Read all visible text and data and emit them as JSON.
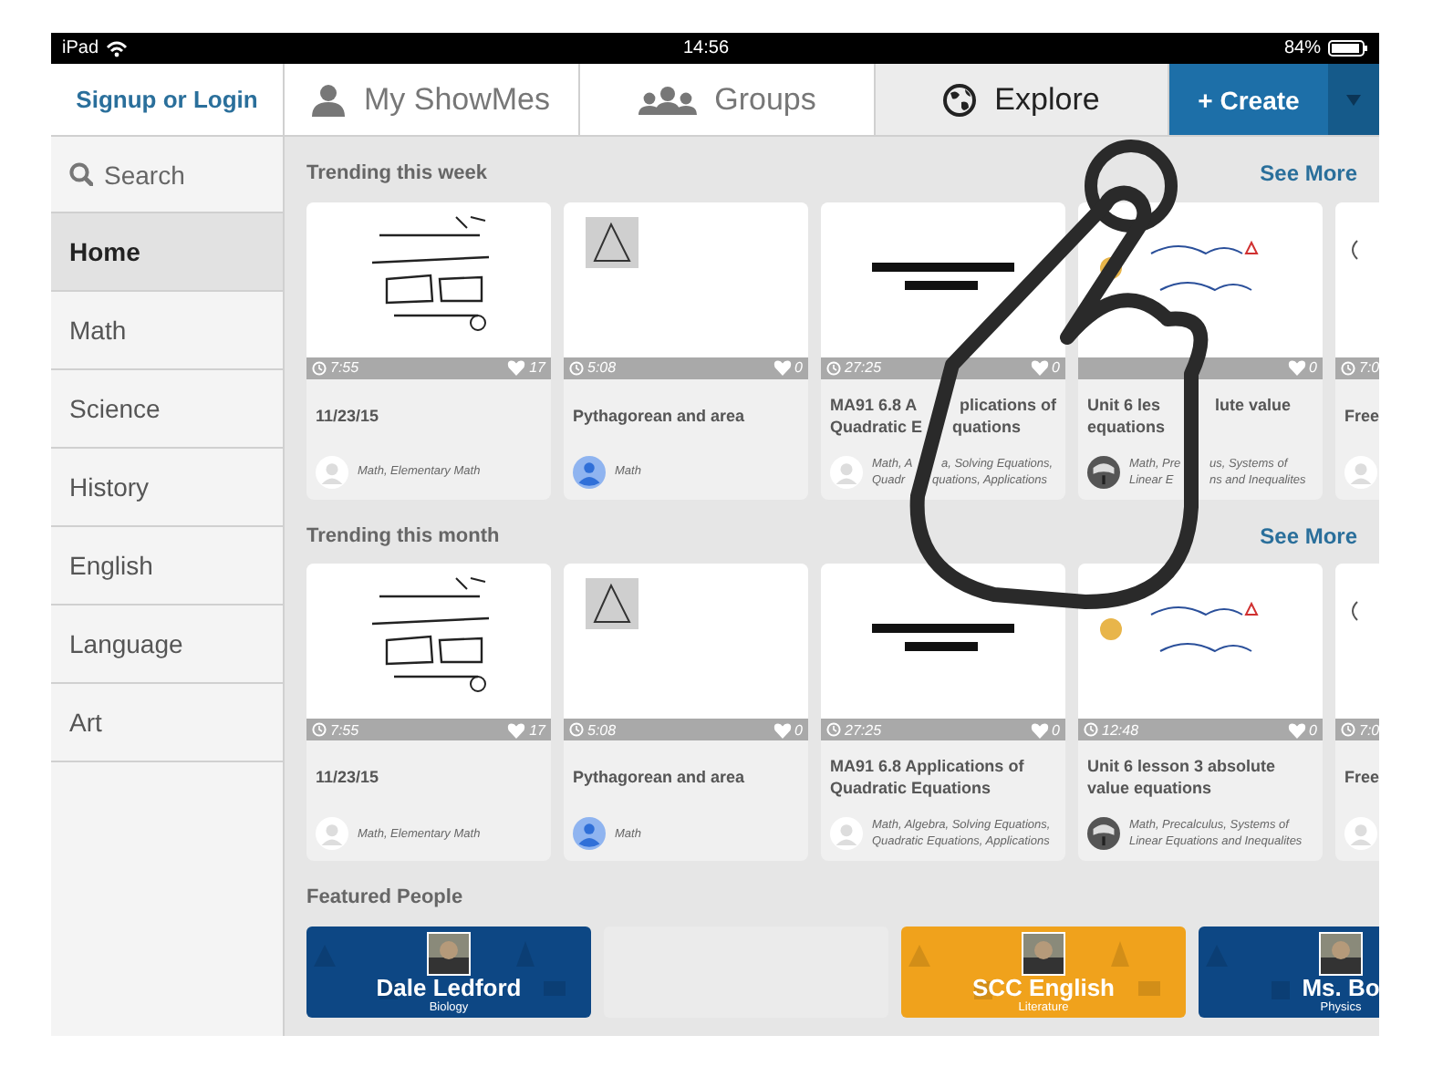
{
  "status_bar": {
    "device": "iPad",
    "time": "14:56",
    "battery": "84%"
  },
  "nav": {
    "login": "Signup or Login",
    "tabs": [
      {
        "label": "My ShowMes",
        "selected": false
      },
      {
        "label": "Groups",
        "selected": false
      },
      {
        "label": "Explore",
        "selected": true
      }
    ],
    "create": "+ Create"
  },
  "sidebar": {
    "search": "Search",
    "items": [
      {
        "label": "Home",
        "selected": true
      },
      {
        "label": "Math",
        "selected": false
      },
      {
        "label": "Science",
        "selected": false
      },
      {
        "label": "History",
        "selected": false
      },
      {
        "label": "English",
        "selected": false
      },
      {
        "label": "Language",
        "selected": false
      },
      {
        "label": "Art",
        "selected": false
      }
    ]
  },
  "sections": [
    {
      "title": "Trending this week",
      "more": "See More",
      "cards": [
        {
          "duration": "7:55",
          "likes": "17",
          "title": "11/23/15",
          "tags": "Math, Elementary Math"
        },
        {
          "duration": "5:08",
          "likes": "0",
          "title": "Pythagorean and area",
          "tags": "Math"
        },
        {
          "duration": "27:25",
          "likes": "0",
          "title_parts": [
            [
              "MA91 6.8 A",
              "plications of"
            ],
            [
              "Quadratic E",
              "quations"
            ]
          ],
          "tag_parts": [
            [
              "Math, A",
              "a, Solving Equations,"
            ],
            [
              "Quadr",
              "quations, Applications"
            ]
          ]
        },
        {
          "likes": "0",
          "title_parts": [
            [
              "Unit 6 les",
              "lute value"
            ],
            [
              "equations"
            ]
          ],
          "tag_parts": [
            [
              "Math, Pre",
              "us, Systems of"
            ],
            [
              "Linear E",
              "ns and Inequalites"
            ]
          ]
        },
        {
          "duration": "7:0",
          "title": "Free"
        }
      ]
    },
    {
      "title": "Trending this month",
      "more": "See More",
      "cards": [
        {
          "duration": "7:55",
          "likes": "17",
          "title": "11/23/15",
          "tags": "Math, Elementary Math"
        },
        {
          "duration": "5:08",
          "likes": "0",
          "title": "Pythagorean and area",
          "tags": "Math"
        },
        {
          "duration": "27:25",
          "likes": "0",
          "title": "MA91 6.8 Applications of Quadratic Equations",
          "tags": "Math, Algebra, Solving Equations, Quadratic Equations, Applications"
        },
        {
          "duration": "12:48",
          "likes": "0",
          "title": "Unit 6 lesson 3 absolute value equations",
          "tags": "Math, Precalculus, Systems of Linear Equations and Inequalites"
        },
        {
          "duration": "7:0",
          "title": "Free"
        }
      ]
    }
  ],
  "featured": {
    "title": "Featured People",
    "people": [
      {
        "kind": "banner",
        "name": "Dale Ledford",
        "subject": "Biology",
        "color": "#0d4784"
      },
      {
        "kind": "placeholder"
      },
      {
        "kind": "banner",
        "name": "SCC English",
        "subject": "Literature",
        "color": "#f0a21c"
      },
      {
        "kind": "banner",
        "name": "Ms. Bo",
        "subject": "Physics",
        "color": "#0d4784"
      }
    ]
  }
}
